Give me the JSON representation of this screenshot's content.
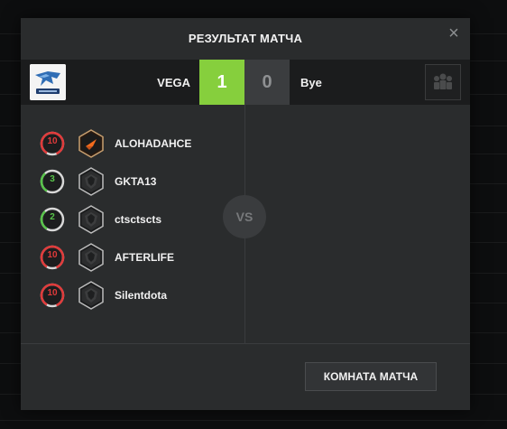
{
  "modal": {
    "title": "РЕЗУЛЬТАТ МАТЧА",
    "close_label": "×"
  },
  "match": {
    "team_left": {
      "name": "VEGA",
      "score": "1",
      "logo": "vega-logo"
    },
    "team_right": {
      "name": "Bye",
      "score": "0",
      "logo": "placeholder-logo"
    },
    "winner_color": "#86cf3d"
  },
  "vs_label": "VS",
  "players": [
    {
      "level": "10",
      "name": "ALOHADAHCE",
      "level_color": "#e03a3a",
      "avatar": "orange-hex-avatar"
    },
    {
      "level": "3",
      "name": "GKTA13",
      "level_color": "#58c44a",
      "avatar": "default-hex-avatar"
    },
    {
      "level": "2",
      "name": "ctsctscts",
      "level_color": "#58c44a",
      "avatar": "default-hex-avatar"
    },
    {
      "level": "10",
      "name": "AFTERLIFE",
      "level_color": "#e03a3a",
      "avatar": "default-hex-avatar"
    },
    {
      "level": "10",
      "name": "Silentdota",
      "level_color": "#e03a3a",
      "avatar": "default-hex-avatar"
    }
  ],
  "room_button_label": "КОМНАТА МАТЧА"
}
